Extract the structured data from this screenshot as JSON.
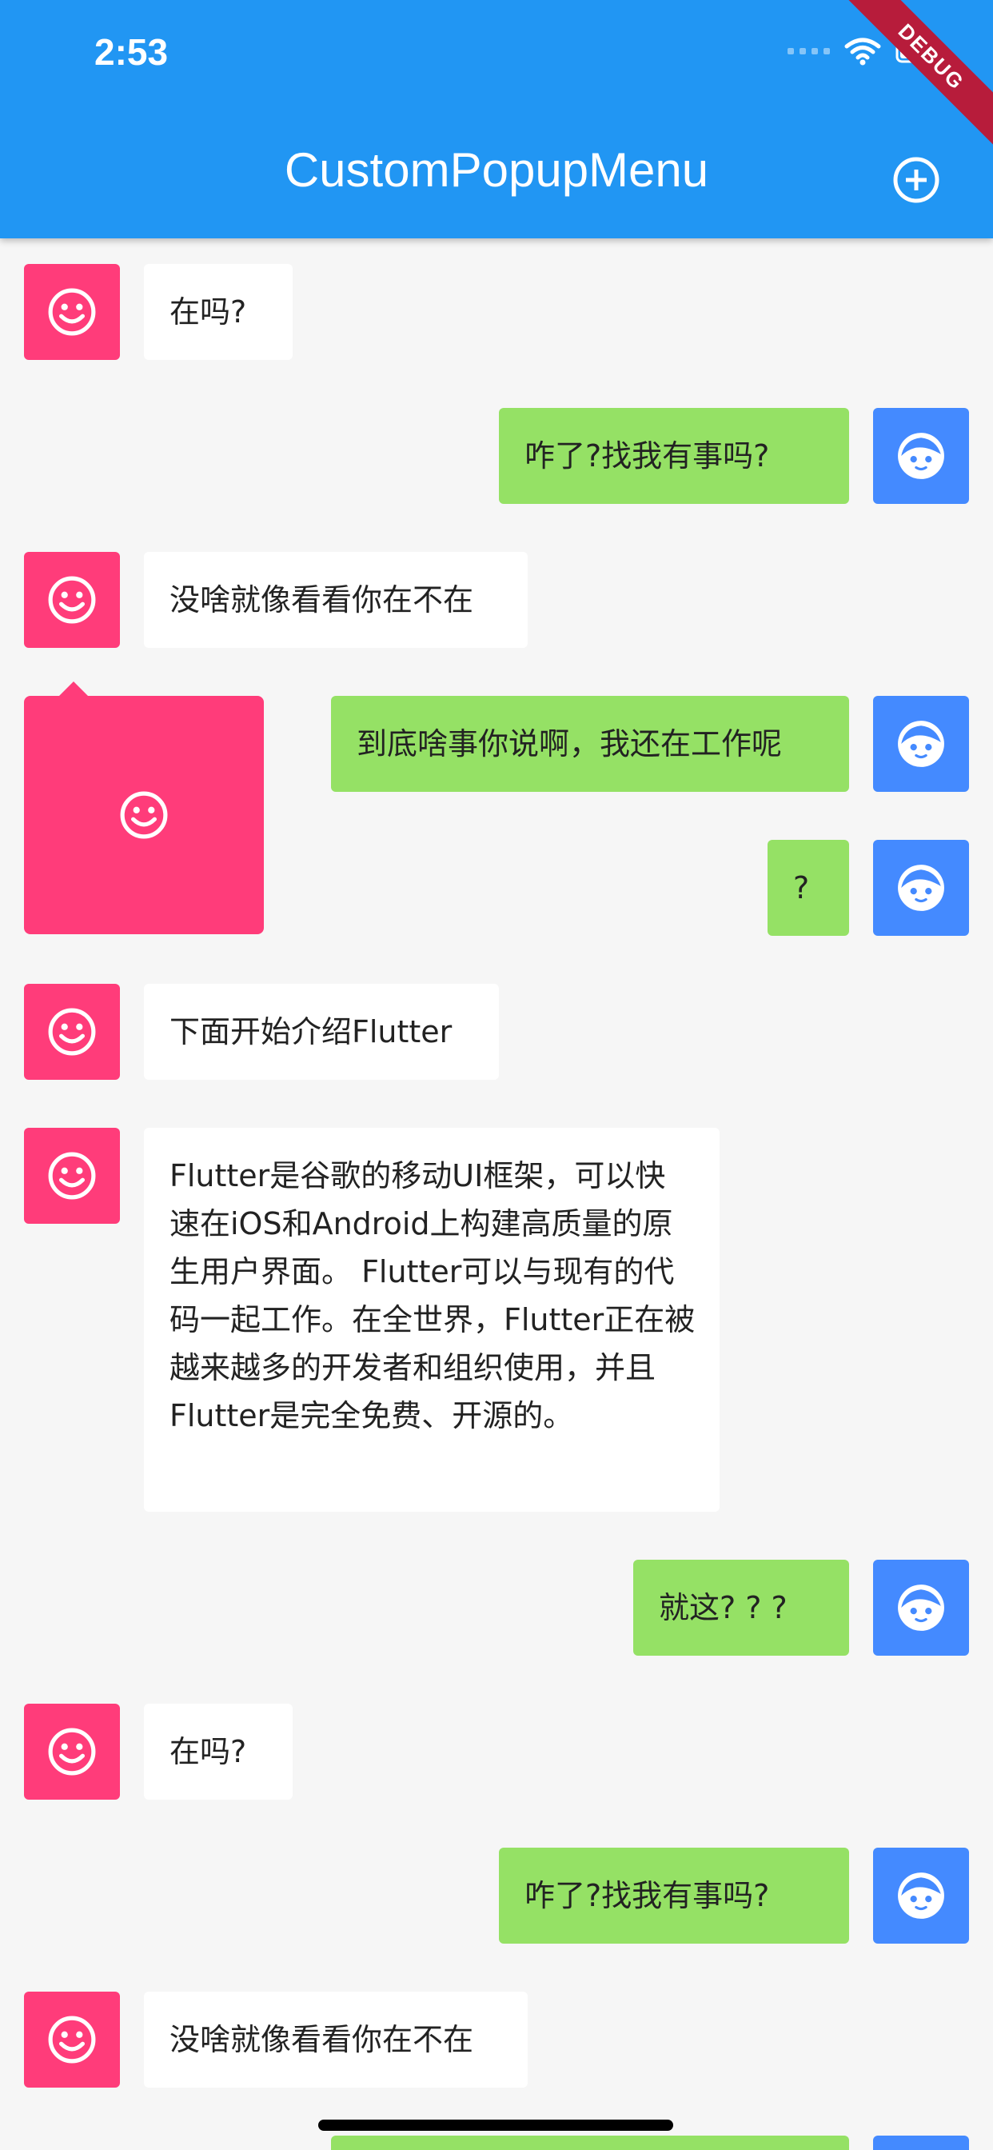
{
  "status_bar": {
    "time": "2:53"
  },
  "app_bar": {
    "title": "CustomPopupMenu",
    "action_icon": "add-circle-icon"
  },
  "debug_banner": "DEBUG",
  "popup": {
    "icon": "smiley-icon"
  },
  "messages": [
    {
      "side": "left",
      "text": "在吗?"
    },
    {
      "side": "right",
      "text": "咋了?找我有事吗?"
    },
    {
      "side": "left",
      "text": "没啥就像看看你在不在"
    },
    {
      "side": "right",
      "text": "到底啥事你说啊，我还在工作呢"
    },
    {
      "side": "right",
      "text": "?"
    },
    {
      "side": "left",
      "text": "下面开始介绍Flutter"
    },
    {
      "side": "left",
      "text": "Flutter是谷歌的移动UI框架，可以快速在iOS和Android上构建高质量的原生用户界面。 Flutter可以与现有的代码一起工作。在全世界，Flutter正在被越来越多的开发者和组织使用，并且Flutter是完全免费、开源的。"
    },
    {
      "side": "right",
      "text": "就这? ? ?"
    },
    {
      "side": "left",
      "text": "在吗?"
    },
    {
      "side": "right",
      "text": "咋了?找我有事吗?"
    },
    {
      "side": "left",
      "text": "没啥就像看看你在不在"
    }
  ],
  "colors": {
    "app_bar": "#2196f3",
    "left_avatar": "#ff3c7a",
    "right_avatar": "#448aff",
    "right_bubble": "#95e165",
    "left_bubble": "#ffffff"
  }
}
